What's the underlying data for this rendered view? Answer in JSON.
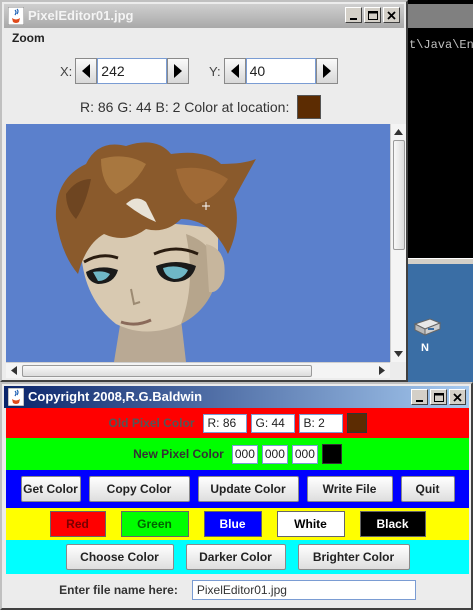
{
  "terminal": {
    "path_text": "t\\Java\\En"
  },
  "desktop": {
    "icon_label": "N"
  },
  "editor_window": {
    "title": "PixelEditor01.jpg",
    "menu": [
      "Zoom"
    ],
    "x_label": "X:",
    "x_value": "242",
    "y_label": "Y:",
    "y_value": "40",
    "rgb_text": "R: 86 G: 44 B: 2 Color at location:",
    "location_color": "#5c2c02"
  },
  "control_window": {
    "title": "Copyright 2008,R.G.Baldwin",
    "old_pixel": {
      "label": "Old Pixel Color",
      "r": "R: 86",
      "g": "G: 44",
      "b": "B: 2",
      "swatch": "#5c2c02"
    },
    "new_pixel": {
      "label": "New Pixel Color",
      "r": "000",
      "g": "000",
      "b": "000",
      "swatch": "#000000"
    },
    "action_buttons": [
      "Get Color",
      "Copy Color",
      "Update Color",
      "Write File",
      "Quit"
    ],
    "color_buttons": [
      {
        "label": "Red",
        "bg": "#ff0000",
        "fg": "#7a0000"
      },
      {
        "label": "Green",
        "bg": "#00ff00",
        "fg": "#006400"
      },
      {
        "label": "Blue",
        "bg": "#0000ff",
        "fg": "#ffffff"
      },
      {
        "label": "White",
        "bg": "#ffffff",
        "fg": "#000000"
      },
      {
        "label": "Black",
        "bg": "#000000",
        "fg": "#ffffff"
      }
    ],
    "adjust_buttons": [
      "Choose Color",
      "Darker Color",
      "Brighter Color"
    ],
    "file": {
      "label": "Enter file name here:",
      "value": "PixelEditor01.jpg"
    }
  }
}
